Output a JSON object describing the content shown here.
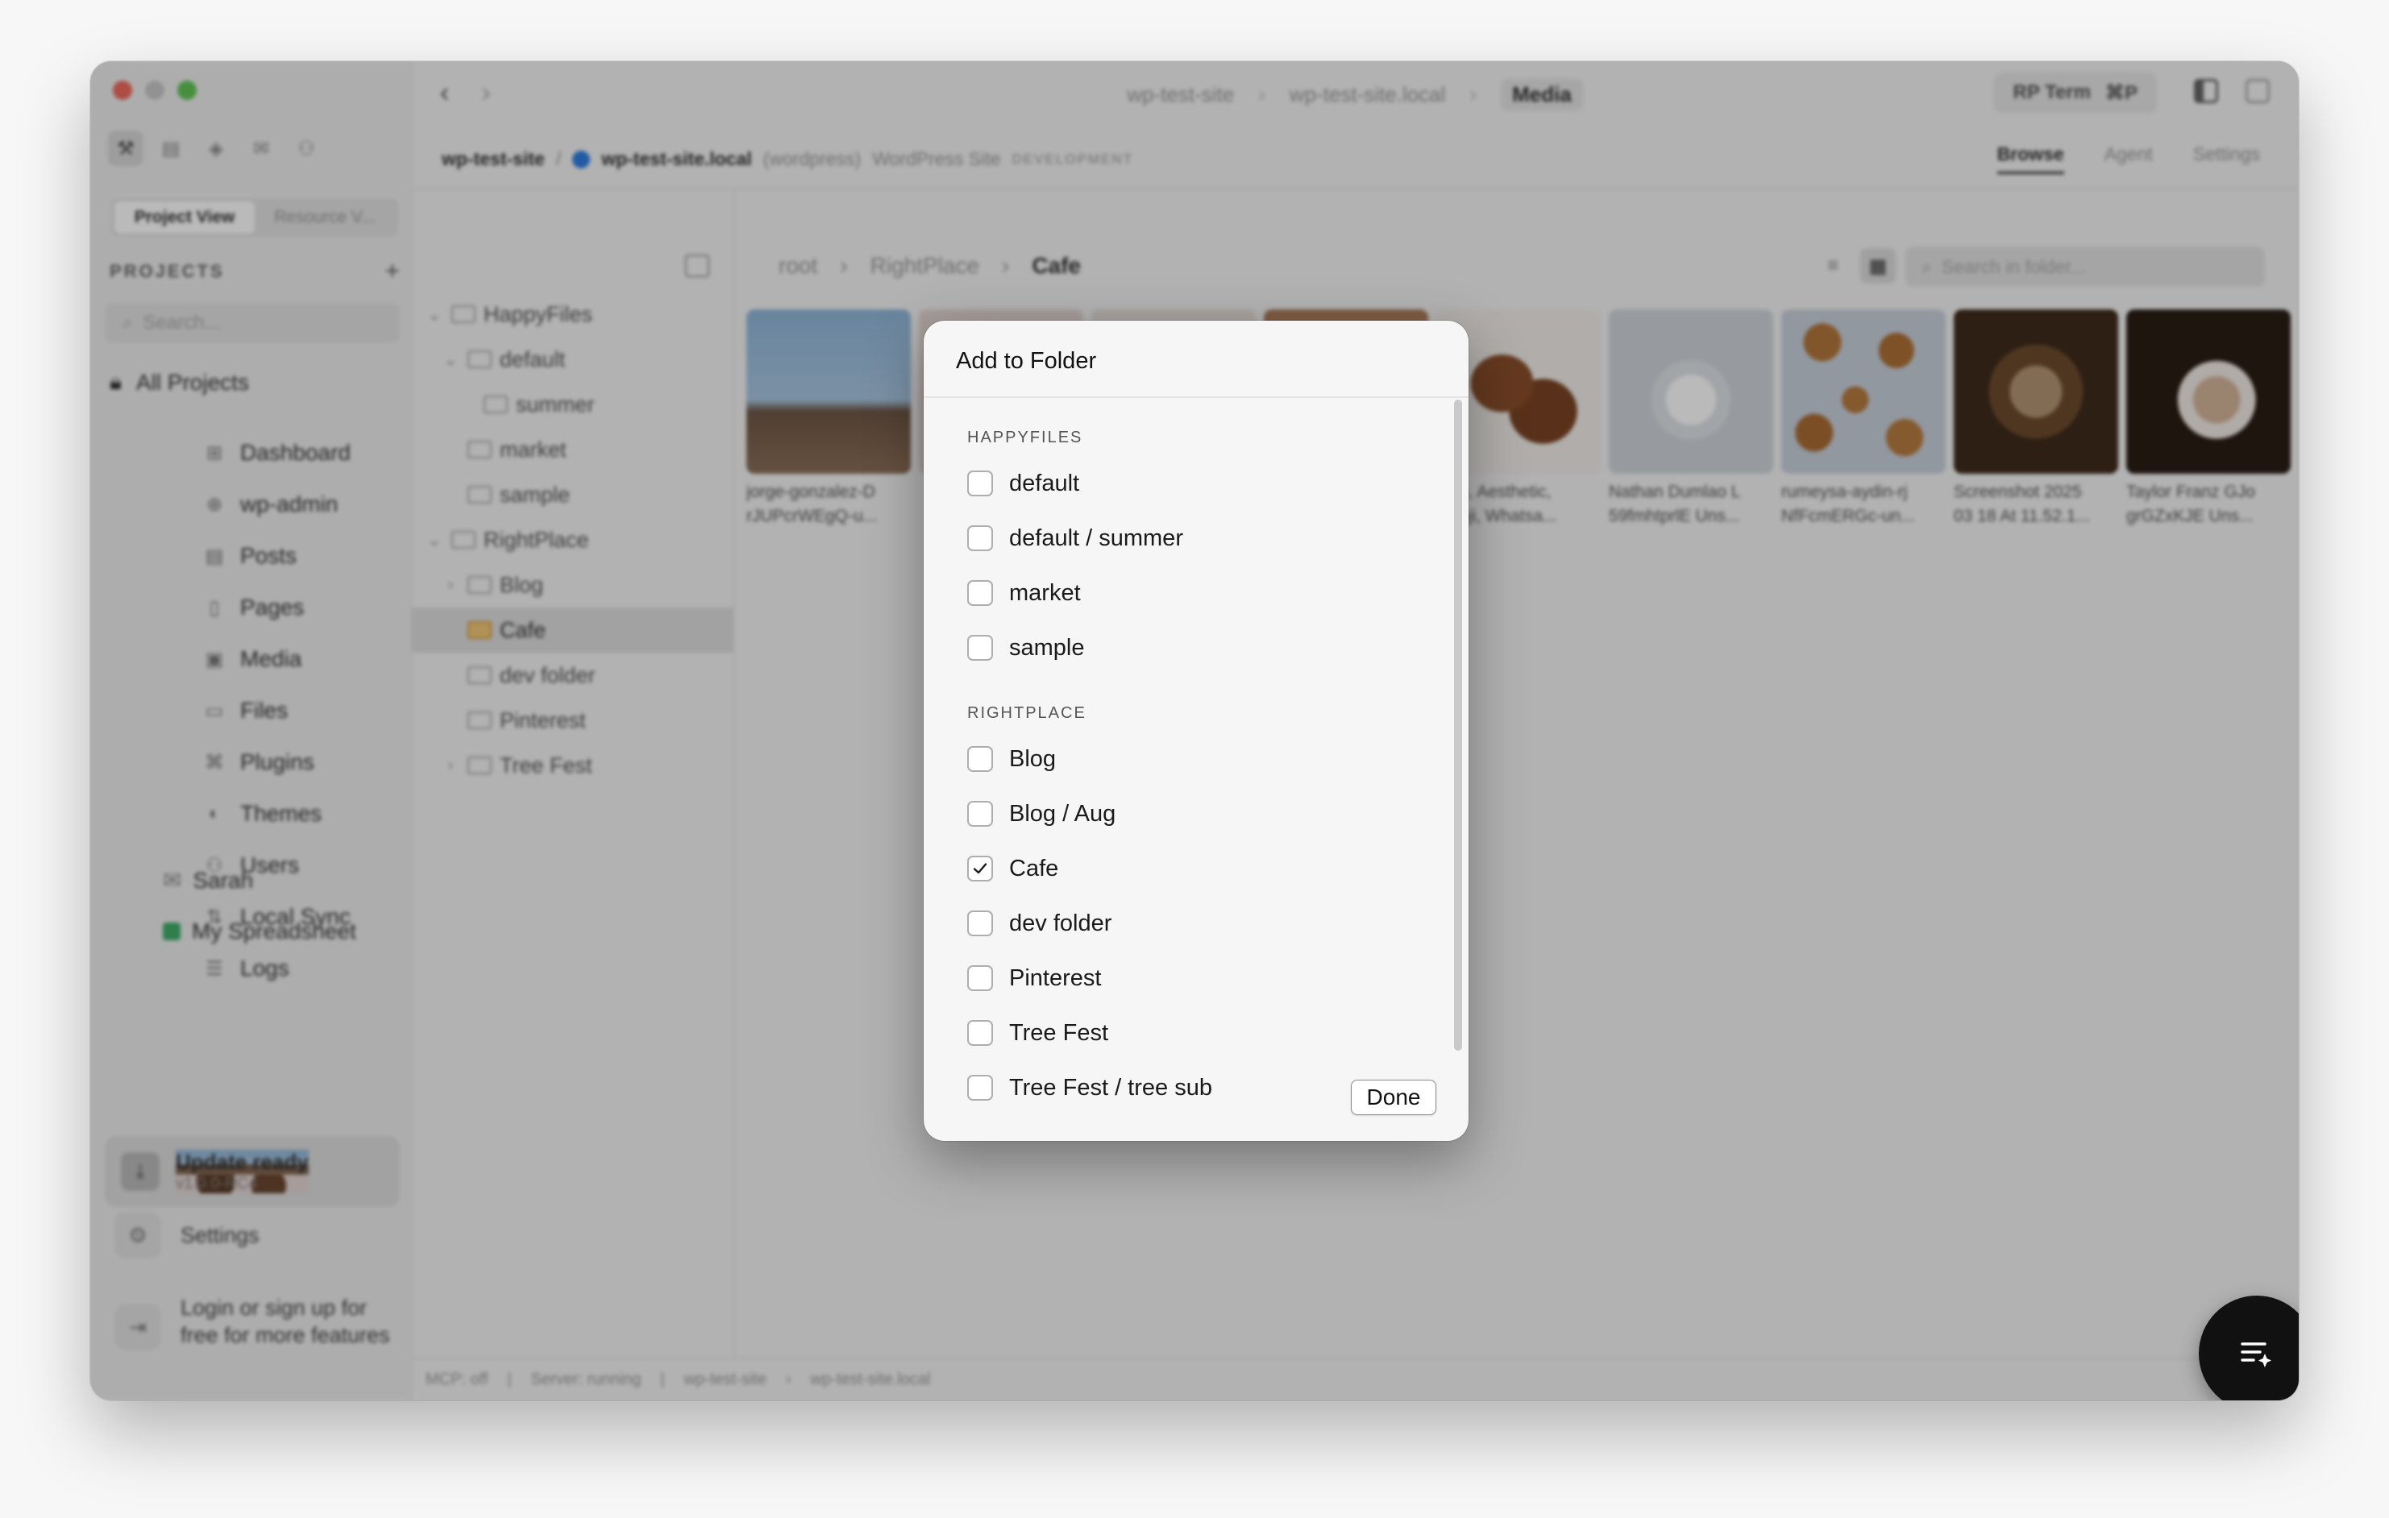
{
  "sidebar": {
    "view_tabs": [
      "Project View",
      "Resource V..."
    ],
    "projects_heading": "PROJECTS",
    "projects_add": "+",
    "search_placeholder": "Search...",
    "all_projects": "All Projects",
    "items": [
      {
        "label": "Dashboard",
        "icon": "dashboard-icon"
      },
      {
        "label": "wp-admin",
        "icon": "wordpress-icon"
      },
      {
        "label": "Posts",
        "icon": "posts-icon"
      },
      {
        "label": "Pages",
        "icon": "pages-icon"
      },
      {
        "label": "Media",
        "icon": "media-icon"
      },
      {
        "label": "Files",
        "icon": "files-icon"
      },
      {
        "label": "Plugins",
        "icon": "plugins-icon"
      },
      {
        "label": "Themes",
        "icon": "themes-icon"
      },
      {
        "label": "Users",
        "icon": "users-icon"
      },
      {
        "label": "Local Sync",
        "icon": "sync-icon"
      },
      {
        "label": "Logs",
        "icon": "logs-icon"
      }
    ],
    "extra": [
      "Sarah",
      "My Spreadsheet"
    ],
    "update": {
      "title": "Update ready",
      "version": "v1.0.0-RC4"
    },
    "settings": "Settings",
    "login": "Login or sign up for free for more features"
  },
  "topbar": {
    "crumbs": [
      "wp-test-site",
      "wp-test-site.local",
      "Media"
    ],
    "rp_term": "RP Term",
    "rp_shortcut": "⌘P"
  },
  "site": {
    "name": "wp-test-site",
    "host": "wp-test-site.local",
    "type": "(wordpress)",
    "desc": "WordPress Site",
    "env": "DEVELOPMENT",
    "tabs": [
      "Browse",
      "Agent",
      "Settings"
    ]
  },
  "tree": [
    {
      "label": "HappyFiles",
      "depth": 0,
      "caret": "⌄"
    },
    {
      "label": "default",
      "depth": 1,
      "caret": "⌄"
    },
    {
      "label": "summer",
      "depth": 2,
      "caret": ""
    },
    {
      "label": "market",
      "depth": 1,
      "caret": ""
    },
    {
      "label": "sample",
      "depth": 1,
      "caret": ""
    },
    {
      "label": "RightPlace",
      "depth": 0,
      "caret": "⌄"
    },
    {
      "label": "Blog",
      "depth": 1,
      "caret": "›"
    },
    {
      "label": "Cafe",
      "depth": 1,
      "caret": "",
      "selected": true
    },
    {
      "label": "dev folder",
      "depth": 1,
      "caret": ""
    },
    {
      "label": "Pinterest",
      "depth": 1,
      "caret": ""
    },
    {
      "label": "Tree Fest",
      "depth": 1,
      "caret": "›"
    }
  ],
  "content": {
    "crumbs": [
      "root",
      "RightPlace",
      "Cafe"
    ],
    "search_placeholder": "Search in folder...",
    "media": [
      {
        "l1": "jorge-gonzalez-D",
        "l2": "rJUPcrWEgQ-u..."
      },
      {
        "l1": "",
        "l2": ""
      },
      {
        "l1": "",
        "l2": ""
      },
      {
        "l1": "",
        "l2": ""
      },
      {
        "l1": "...us, Aesthetic,",
        "l2": "...soji, Whatsa..."
      },
      {
        "l1": "Nathan Dumlao L",
        "l2": "59fmhtprlE Uns..."
      },
      {
        "l1": "rumeysa-aydin-rj",
        "l2": "NfFcmERGc-un..."
      },
      {
        "l1": "Screenshot 2025",
        "l2": "03 18 At 11.52.1..."
      },
      {
        "l1": "Taylor Franz GJo",
        "l2": "grGZxKJE Uns..."
      }
    ]
  },
  "status": [
    "MCP: off",
    "Server: running",
    "wp-test-site",
    "wp-test-site.local"
  ],
  "modal": {
    "title": "Add to Folder",
    "groups": [
      {
        "heading": "HAPPYFILES",
        "options": [
          {
            "label": "default",
            "checked": false
          },
          {
            "label": "default / summer",
            "checked": false
          },
          {
            "label": "market",
            "checked": false
          },
          {
            "label": "sample",
            "checked": false
          }
        ]
      },
      {
        "heading": "RIGHTPLACE",
        "options": [
          {
            "label": "Blog",
            "checked": false
          },
          {
            "label": "Blog / Aug",
            "checked": false
          },
          {
            "label": "Cafe",
            "checked": true
          },
          {
            "label": "dev folder",
            "checked": false
          },
          {
            "label": "Pinterest",
            "checked": false
          },
          {
            "label": "Tree Fest",
            "checked": false
          },
          {
            "label": "Tree Fest / tree sub",
            "checked": false
          }
        ]
      }
    ],
    "done_label": "Done"
  },
  "colors": {
    "accent_check": "#1a1a1a",
    "fab": "#111111",
    "selected_folder": "#f2c976"
  }
}
